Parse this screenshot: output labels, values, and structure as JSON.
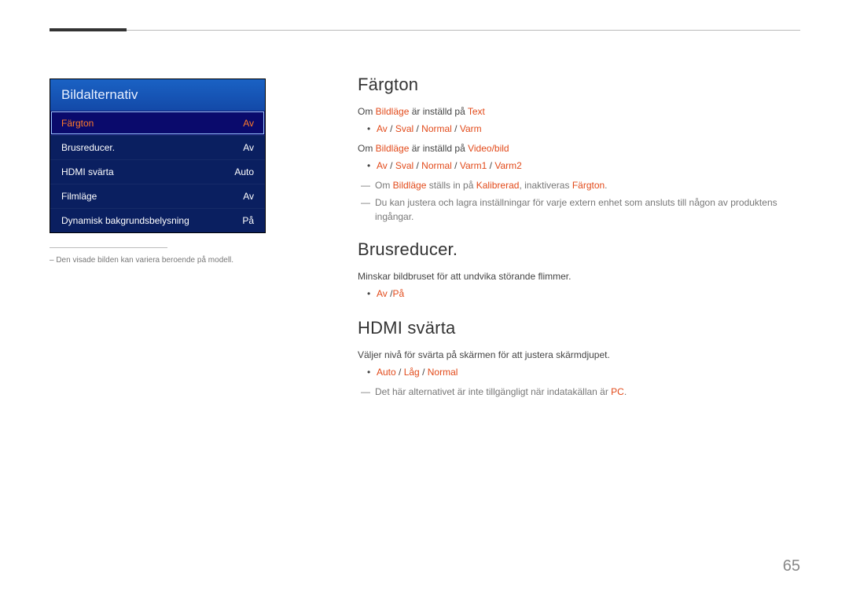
{
  "menu": {
    "title": "Bildalternativ",
    "items": [
      {
        "label": "Färgton",
        "value": "Av",
        "selected": true
      },
      {
        "label": "Brusreducer.",
        "value": "Av",
        "selected": false
      },
      {
        "label": "HDMI svärta",
        "value": "Auto",
        "selected": false
      },
      {
        "label": "Filmläge",
        "value": "Av",
        "selected": false
      },
      {
        "label": "Dynamisk bakgrundsbelysning",
        "value": "På",
        "selected": false
      }
    ]
  },
  "footnote": "– Den visade bilden kan variera beroende på modell.",
  "sections": {
    "fargton": {
      "heading": "Färgton",
      "line1": {
        "pre": "Om ",
        "em1": "Bildläge",
        "mid": " är inställd på ",
        "em2": "Text"
      },
      "opts1": {
        "a": "Av",
        "b": "Sval",
        "c": "Normal",
        "d": "Varm"
      },
      "line2": {
        "pre": "Om ",
        "em1": "Bildläge",
        "mid": " är inställd på ",
        "em2": "Video/bild"
      },
      "opts2": {
        "a": "Av",
        "b": "Sval",
        "c": "Normal",
        "d": "Varm1",
        "e": "Varm2"
      },
      "note1": {
        "pre": "Om ",
        "em1": "Bildläge",
        "mid": " ställs in på ",
        "em2": "Kalibrerad",
        "mid2": ", inaktiveras ",
        "em3": "Färgton",
        "post": "."
      },
      "note2": "Du kan justera och lagra inställningar för varje extern enhet som ansluts till någon av produktens ingångar."
    },
    "brus": {
      "heading": "Brusreducer.",
      "desc": "Minskar bildbruset för att undvika störande flimmer.",
      "opts": {
        "a": "Av",
        "sep": " /",
        "b": "På"
      }
    },
    "hdmi": {
      "heading": "HDMI svärta",
      "desc": "Väljer nivå för svärta på skärmen för att justera skärmdjupet.",
      "opts": {
        "a": "Auto",
        "b": "Låg",
        "c": "Normal"
      },
      "note": {
        "pre": "Det här alternativet är inte tillgängligt när indatakällan är ",
        "em1": "PC",
        "post": "."
      }
    }
  },
  "page_number": "65"
}
